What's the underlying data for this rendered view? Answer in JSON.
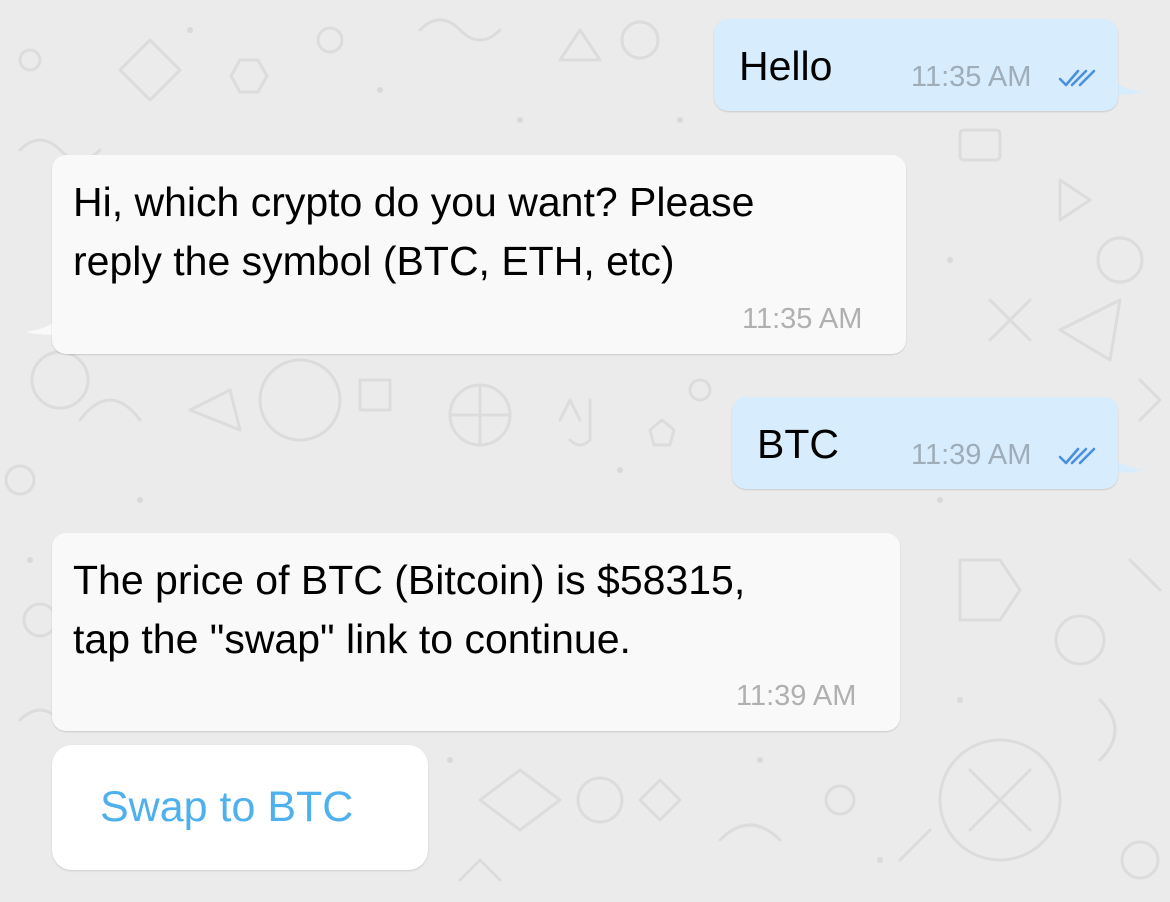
{
  "chat": {
    "messages": [
      {
        "direction": "outgoing",
        "text_lines": [
          "Hello"
        ],
        "time": "11:35 AM",
        "status": "double-check-icon"
      },
      {
        "direction": "incoming",
        "text_lines": [
          "Hi, which crypto do you want? Please",
          "reply the symbol (BTC, ETH, etc)"
        ],
        "time": "11:35 AM"
      },
      {
        "direction": "outgoing",
        "text_lines": [
          "BTC"
        ],
        "time": "11:39 AM",
        "status": "double-check-icon"
      },
      {
        "direction": "incoming",
        "text_lines": [
          "The price of BTC (Bitcoin) is $58315,",
          "tap the \"swap\" link to continue."
        ],
        "time": "11:39 AM"
      }
    ],
    "inline_button": {
      "label": "Swap to BTC"
    }
  },
  "colors": {
    "background": "#ebebeb",
    "outgoing_bubble": "#d7ecfd",
    "incoming_bubble": "#f9f9f9",
    "read_check": "#4a90e2",
    "link_blue": "#4fb0ee"
  }
}
